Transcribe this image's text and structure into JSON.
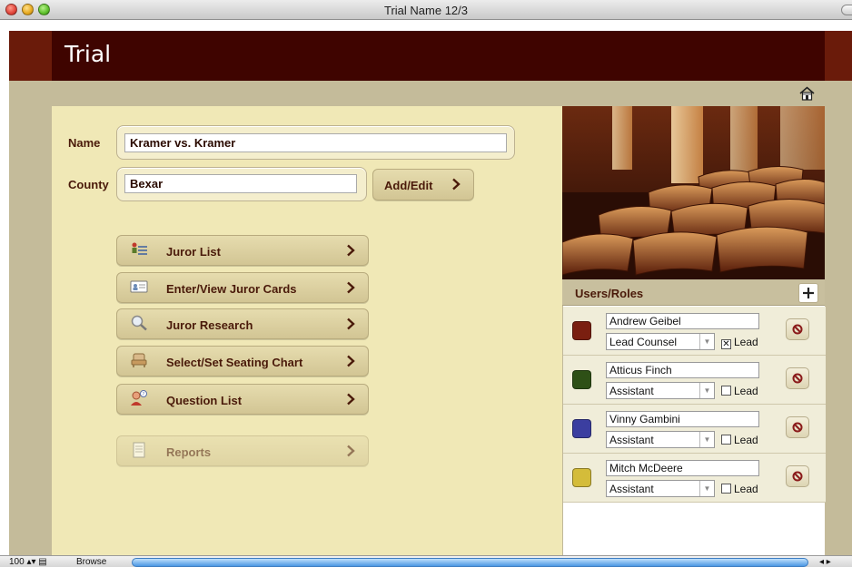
{
  "window": {
    "title": "Trial Name 12/3"
  },
  "header": {
    "title": "Trial"
  },
  "form": {
    "name_label": "Name",
    "name_value": "Kramer vs. Kramer",
    "county_label": "County",
    "county_value": "Bexar",
    "add_edit_label": "Add/Edit"
  },
  "nav": {
    "items": [
      {
        "label": "Juror List",
        "icon": "juror-list-icon"
      },
      {
        "label": "Enter/View Juror Cards",
        "icon": "juror-cards-icon"
      },
      {
        "label": "Juror Research",
        "icon": "magnifier-icon"
      },
      {
        "label": "Select/Set Seating Chart",
        "icon": "seat-icon"
      },
      {
        "label": "Question List",
        "icon": "question-person-icon"
      },
      {
        "label": "Reports",
        "icon": "reports-icon",
        "disabled": true
      }
    ]
  },
  "users_roles": {
    "title": "Users/Roles",
    "lead_label": "Lead",
    "users": [
      {
        "name": "Andrew Geibel",
        "role": "Lead Counsel",
        "lead": true,
        "color": "#7a1f10"
      },
      {
        "name": "Atticus Finch",
        "role": "Assistant",
        "lead": false,
        "color": "#2e5016"
      },
      {
        "name": "Vinny Gambini",
        "role": "Assistant",
        "lead": false,
        "color": "#3b3ea0"
      },
      {
        "name": "Mitch McDeere",
        "role": "Assistant",
        "lead": false,
        "color": "#d4bc3a"
      }
    ]
  },
  "statusbar": {
    "zoom": "100",
    "mode": "Browse"
  },
  "colors": {
    "header": "#3f0400",
    "accent_band": "#6a1b0a",
    "form_bg": "#f0e8b6",
    "frame": "#c4bb9a",
    "label": "#4a1a0a"
  }
}
